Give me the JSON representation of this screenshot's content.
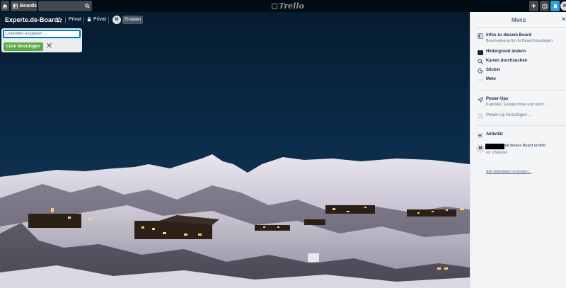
{
  "topbar": {
    "boards_label": "Boards",
    "logo_text": "Trello",
    "icons": [
      "home-icon",
      "boards-icon",
      "search-icon",
      "plus-icon",
      "info-icon",
      "bell-icon"
    ],
    "avatar_initial": "M"
  },
  "board": {
    "title": "Experte.de-Board",
    "team_label": "Privat",
    "visibility_label": "Privat",
    "member_initial": "M",
    "invite_label": "Einladen"
  },
  "composer": {
    "placeholder": "Listentitel eingeben ...",
    "add_button": "Liste hinzufügen"
  },
  "menu": {
    "title": "Menü",
    "items": [
      {
        "title": "Infos zu diesem Board",
        "subtitle": "Beschreibung für Ihr Board hinzufügen"
      },
      {
        "title": "Hintergrund ändern"
      },
      {
        "title": "Karten durchsuchen"
      },
      {
        "title": "Sticker"
      },
      {
        "title": "Mehr"
      }
    ],
    "powerups": {
      "title": "Power-Ups",
      "subtitle": "Kalender, Google Drive und mehr ...",
      "add_label": "Power-Up hinzufügen ..."
    },
    "activity": {
      "title": "Aktivität",
      "avatar_initial": "M",
      "entry_text": "hat dieses Board erstellt",
      "entry_time": "vor 3 Minuten",
      "all_link": "Alle Aktivitäten anzeigen..."
    }
  },
  "colors": {
    "accent": "#0079bf",
    "add_button": "#5aac44",
    "notification": "#29a3d9",
    "sky": "#0b2a45"
  }
}
